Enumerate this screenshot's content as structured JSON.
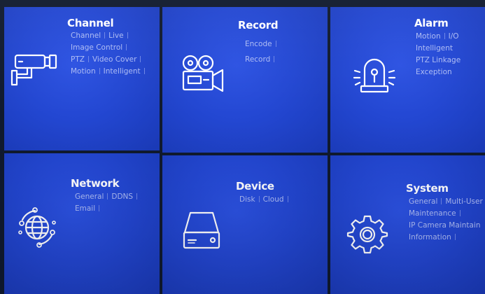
{
  "tiles": {
    "channel": {
      "title": "Channel",
      "icon": "camera-icon",
      "links": [
        "Channel",
        "Live",
        "Image Control",
        "PTZ",
        "Video Cover",
        "Motion",
        "Intelligent"
      ]
    },
    "record": {
      "title": "Record",
      "icon": "film-camera-icon",
      "links": [
        "Encode",
        "Record"
      ]
    },
    "alarm": {
      "title": "Alarm",
      "icon": "alarm-beacon-icon",
      "links": [
        "Motion",
        "I/O",
        "Intelligent",
        "PTZ Linkage",
        "Exception"
      ]
    },
    "network": {
      "title": "Network",
      "icon": "globe-icon",
      "links": [
        "General",
        "DDNS",
        "Email"
      ]
    },
    "device": {
      "title": "Device",
      "icon": "hard-drive-icon",
      "links": [
        "Disk",
        "Cloud"
      ]
    },
    "system": {
      "title": "System",
      "icon": "gear-icon",
      "links": [
        "General",
        "Multi-User",
        "Maintenance",
        "IP Camera Maintain",
        "Information"
      ]
    }
  },
  "colors": {
    "tile": "#2347d2",
    "divider": "#0b1020",
    "title": "#ffffff",
    "link": "#aebcf4"
  }
}
